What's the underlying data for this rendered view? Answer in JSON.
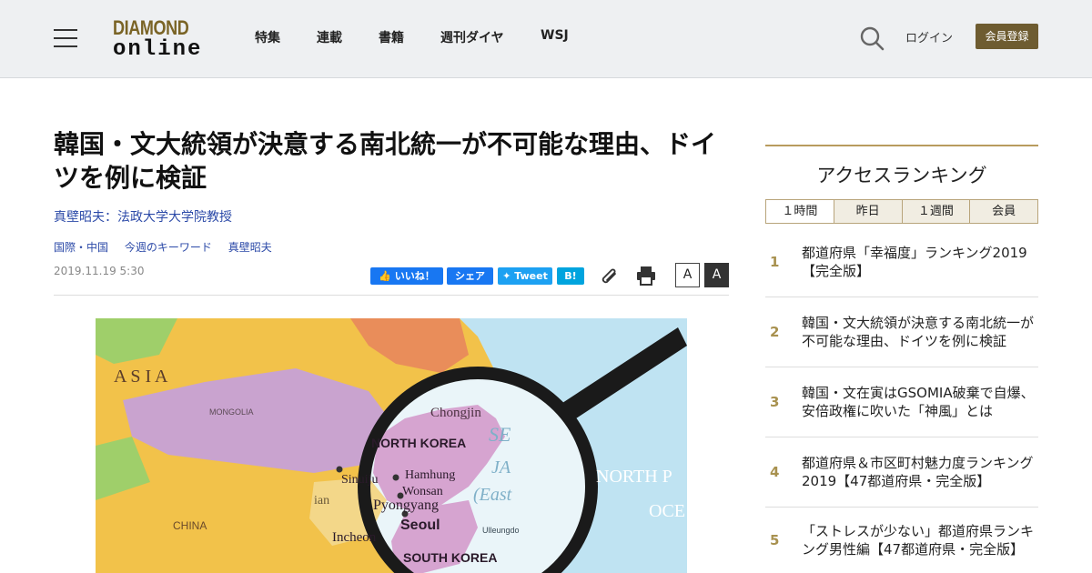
{
  "header": {
    "logo_top": "DIAMOND",
    "logo_bottom": "online",
    "nav": [
      "特集",
      "連載",
      "書籍",
      "週刊ダイヤ",
      "WSJ"
    ],
    "login": "ログイン",
    "register": "会員登録"
  },
  "article": {
    "title": "韓国・文大統領が決意する南北統一が不可能な理由、ドイツを例に検証",
    "author": "真壁昭夫：法政大学大学院教授",
    "tags": [
      "国際・中国",
      "今週のキーワード",
      "真壁昭夫"
    ],
    "date": "2019.11.19 5:30",
    "share": {
      "like": "いいね！",
      "share": "シェア",
      "tweet": "Tweet",
      "hatena": "B!"
    },
    "font_small": "A",
    "font_large": "A"
  },
  "hero_map": {
    "labels": [
      "A S I A",
      "MONGOLIA",
      "CHINA",
      "Chongjin",
      "NORTH KOREA",
      "Hamhung",
      "Sinuiju",
      "Wonsan",
      "Pyongyang",
      "Seoul",
      "SOUTH KOREA",
      "Incheon",
      "Ulleungdo",
      "SE",
      "JA",
      "(East",
      "NORTH P",
      "OCE",
      "ian"
    ],
    "colors": {
      "land_yellow": "#f2c24a",
      "land_pink": "#c9a3cf",
      "ocean": "#bfe3f2",
      "lens_rim": "#1a1a1a"
    }
  },
  "sidebar": {
    "title": "アクセスランキング",
    "tabs": [
      "１時間",
      "昨日",
      "１週間",
      "会員"
    ],
    "ranking": [
      {
        "num": "1",
        "title": "都道府県「幸福度」ランキング2019【完全版】"
      },
      {
        "num": "2",
        "title": "韓国・文大統領が決意する南北統一が不可能な理由、ドイツを例に検証"
      },
      {
        "num": "3",
        "title": "韓国・文在寅はGSOMIA破棄で自爆、安倍政権に吹いた「神風」とは"
      },
      {
        "num": "4",
        "title": "都道府県＆市区町村魅力度ランキング2019【47都道府県・完全版】"
      },
      {
        "num": "5",
        "title": "「ストレスが少ない」都道府県ランキング男性編【47都道府県・完全版】"
      }
    ]
  },
  "colors": {
    "accent_gold": "#b89b5e",
    "register_bg": "#6e5c31",
    "link_blue": "#2c4aa8"
  }
}
